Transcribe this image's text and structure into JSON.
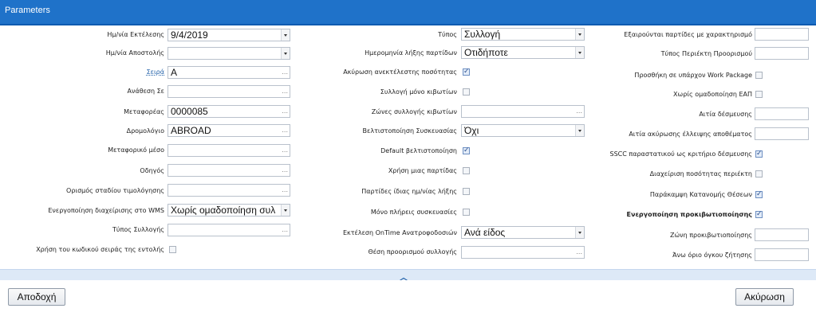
{
  "window": {
    "title": "Parameters"
  },
  "col1": {
    "exec_date_label": "Ημ/νία Εκτέλεσης",
    "exec_date_value": "9/4/2019",
    "ship_date_label": "Ημ/νία Αποστολής",
    "ship_date_value": "",
    "series_label": "Σειρά",
    "series_value": "A",
    "assign_label": "Ανάθεση Σε",
    "assign_value": "",
    "carriers_label": "Μεταφορέας",
    "carriers_value": "0000085",
    "route_label": "Δρομολόγιο",
    "route_value": "ABROAD",
    "vehicle_label": "Μεταφορικό μέσο",
    "vehicle_value": "",
    "driver_label": "Οδηγός",
    "driver_value": "",
    "invoice_stage_label": "Ορισμός σταδίου τιμολόγησης",
    "invoice_stage_value": "",
    "wms_label": "Ενεργοποίηση διαχείρισης στο WMS",
    "wms_value": "Χωρίς ομαδοποίηση συλ",
    "pick_type_label": "Τύπος Συλλογής",
    "pick_type_value": "",
    "use_series_code_label": "Χρήση του κωδικού σειράς της εντολής",
    "use_series_code_checked": false
  },
  "col2": {
    "type_label": "Τύπος",
    "type_value": "Συλλογή",
    "batch_expiry_label": "Ημερομηνία λήξης παρτίδων",
    "batch_expiry_value": "Οτιδήποτε",
    "cancel_unexec_label": "Ακύρωση ανεκτέλεστης ποσότητας",
    "cancel_unexec_checked": true,
    "boxes_only_label": "Συλλογή μόνο κιβωτίων",
    "boxes_only_checked": false,
    "box_zones_label": "Ζώνες συλλογής κιβωτίων",
    "box_zones_value": "",
    "pack_opt_label": "Βελτιστοποίηση Συσκευασίας",
    "pack_opt_value": "Όχι",
    "default_opt_label": "Default βελτιστοποίηση",
    "default_opt_checked": true,
    "single_batch_label": "Χρήση μιας παρτίδας",
    "single_batch_checked": false,
    "same_expiry_label": "Παρτίδες ίδιας ημ/νίας λήξης",
    "same_expiry_checked": false,
    "full_packs_label": "Μόνο πλήρεις συσκευασίες",
    "full_packs_checked": false,
    "ontime_label": "Εκτέλεση OnTime Ανατροφοδοσιών",
    "ontime_value": "Ανά είδος",
    "dest_pos_label": "Θέση προορισμού συλλογής",
    "dest_pos_value": ""
  },
  "col3": {
    "excluded_label": "Εξαιρούνται παρτίδες με χαρακτηρισμό",
    "excluded_value": "",
    "container_type_label": "Τύπος Περιέκτη Προορισμού",
    "container_type_value": "",
    "add_wp_label": "Προσθήκη σε υπάρχον Work Package",
    "add_wp_checked": false,
    "no_group_label": "Χωρίς ομαδοποίηση ΕΑΠ",
    "no_group_checked": false,
    "bind_reason_label": "Αιτία δέσμευσης",
    "bind_reason_value": "",
    "cancel_reason_label": "Αιτία ακύρωσης έλλειψης αποθέματος",
    "cancel_reason_value": "",
    "sscc_label": "SSCC παραστατικού ως κριτήριο δέσμευσης",
    "sscc_checked": true,
    "container_qty_label": "Διαχείριση ποσότητας περιέκτη",
    "container_qty_checked": false,
    "override_alloc_label": "Παράκαμψη Κατανομής Θέσεων",
    "override_alloc_checked": true,
    "pre_label": "Ενεργοποίηση προκιβωτιοποίησης",
    "pre_checked": true,
    "pre_zone_label": "Ζώνη προκιβωτιοποίησης",
    "pre_zone_value": "",
    "upper_volume_label": "Άνω όριο όγκου ζήτησης",
    "upper_volume_value": ""
  },
  "footer": {
    "accept_label": "Αποδοχή",
    "cancel_label": "Ακύρωση"
  }
}
